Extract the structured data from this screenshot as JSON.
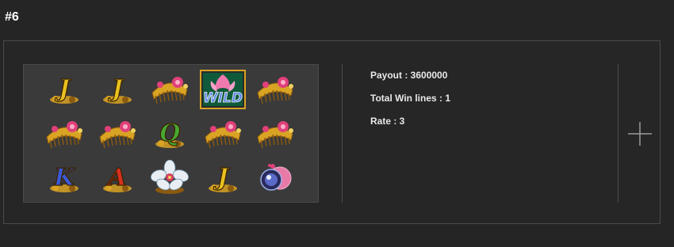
{
  "header": {
    "title": "#6"
  },
  "result": {
    "payout_label": "Payout : 3600000",
    "win_lines_label": "Total Win lines : 1",
    "rate_label": "Rate : 3"
  },
  "reels": [
    [
      "J",
      "J",
      "comb",
      "WILD",
      "comb"
    ],
    [
      "comb",
      "comb",
      "Q",
      "comb",
      "comb"
    ],
    [
      "K",
      "A",
      "flower",
      "J",
      "gem"
    ]
  ],
  "symbols": {
    "J": {
      "label": "J",
      "color": "#e8c020"
    },
    "Q": {
      "label": "Q",
      "color": "#48a830"
    },
    "K": {
      "label": "K",
      "color": "#3a5ad8"
    },
    "A": {
      "label": "A",
      "color": "#d83020"
    },
    "WILD": {
      "label": "WILD",
      "color": "#2a6ad8"
    }
  },
  "colors": {
    "gold": "#d9a324",
    "gold_dark": "#8a5a10",
    "pink": "#e0407a",
    "wild_bg": "#f07ab0"
  }
}
